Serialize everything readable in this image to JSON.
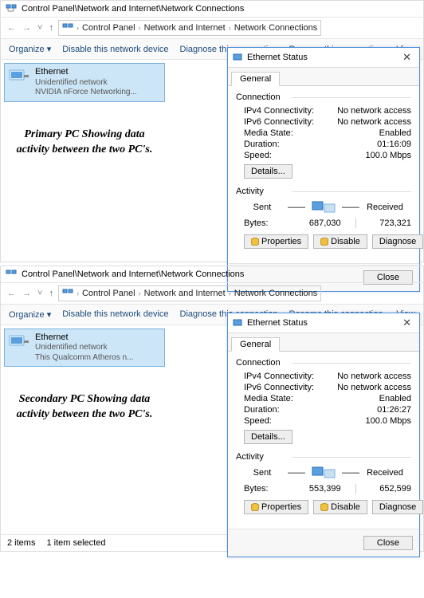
{
  "panels": [
    {
      "pathTitle": "Control Panel\\Network and Internet\\Network Connections",
      "breadcrumbs": [
        "Control Panel",
        "Network and Internet",
        "Network Connections"
      ],
      "toolbar": {
        "organize": "Organize ▾",
        "disable": "Disable this network device",
        "diagnose": "Diagnose this connection",
        "rename": "Rename this connection",
        "view": "View"
      },
      "adapter": {
        "name": "Ethernet",
        "line2": "Unidentified network",
        "line3": "NVIDIA nForce Networking..."
      },
      "caption": "Primary PC Showing data activity between the two PC's.",
      "dialog": {
        "title": "Ethernet Status",
        "tab": "General",
        "section_connection": "Connection",
        "rows": {
          "ipv4_k": "IPv4 Connectivity:",
          "ipv4_v": "No network access",
          "ipv6_k": "IPv6 Connectivity:",
          "ipv6_v": "No network access",
          "media_k": "Media State:",
          "media_v": "Enabled",
          "dur_k": "Duration:",
          "dur_v": "01:16:09",
          "spd_k": "Speed:",
          "spd_v": "100.0 Mbps"
        },
        "details_btn": "Details...",
        "section_activity": "Activity",
        "sent_lbl": "Sent",
        "recv_lbl": "Received",
        "bytes_lbl": "Bytes:",
        "bytes_sent": "687,030",
        "bytes_recv": "723,321",
        "btn_props": "Properties",
        "btn_disable": "Disable",
        "btn_diag": "Diagnose",
        "btn_close": "Close"
      },
      "statusbar": null
    },
    {
      "pathTitle": "Control Panel\\Network and Internet\\Network Connections",
      "breadcrumbs": [
        "Control Panel",
        "Network and Internet",
        "Network Connections"
      ],
      "toolbar": {
        "organize": "Organize ▾",
        "disable": "Disable this network device",
        "diagnose": "Diagnose this connection",
        "rename": "Rename this connection",
        "view": "View"
      },
      "adapter": {
        "name": "Ethernet",
        "line2": "Unidentified network",
        "line3": "This Qualcomm Atheros n..."
      },
      "caption": "Secondary PC Showing data activity between the two PC's.",
      "dialog": {
        "title": "Ethernet Status",
        "tab": "General",
        "section_connection": "Connection",
        "rows": {
          "ipv4_k": "IPv4 Connectivity:",
          "ipv4_v": "No network access",
          "ipv6_k": "IPv6 Connectivity:",
          "ipv6_v": "No network access",
          "media_k": "Media State:",
          "media_v": "Enabled",
          "dur_k": "Duration:",
          "dur_v": "01:26:27",
          "spd_k": "Speed:",
          "spd_v": "100.0 Mbps"
        },
        "details_btn": "Details...",
        "section_activity": "Activity",
        "sent_lbl": "Sent",
        "recv_lbl": "Received",
        "bytes_lbl": "Bytes:",
        "bytes_sent": "553,399",
        "bytes_recv": "652,599",
        "btn_props": "Properties",
        "btn_disable": "Disable",
        "btn_diag": "Diagnose",
        "btn_close": "Close"
      },
      "statusbar": {
        "items": "2 items",
        "selected": "1 item selected"
      }
    }
  ]
}
